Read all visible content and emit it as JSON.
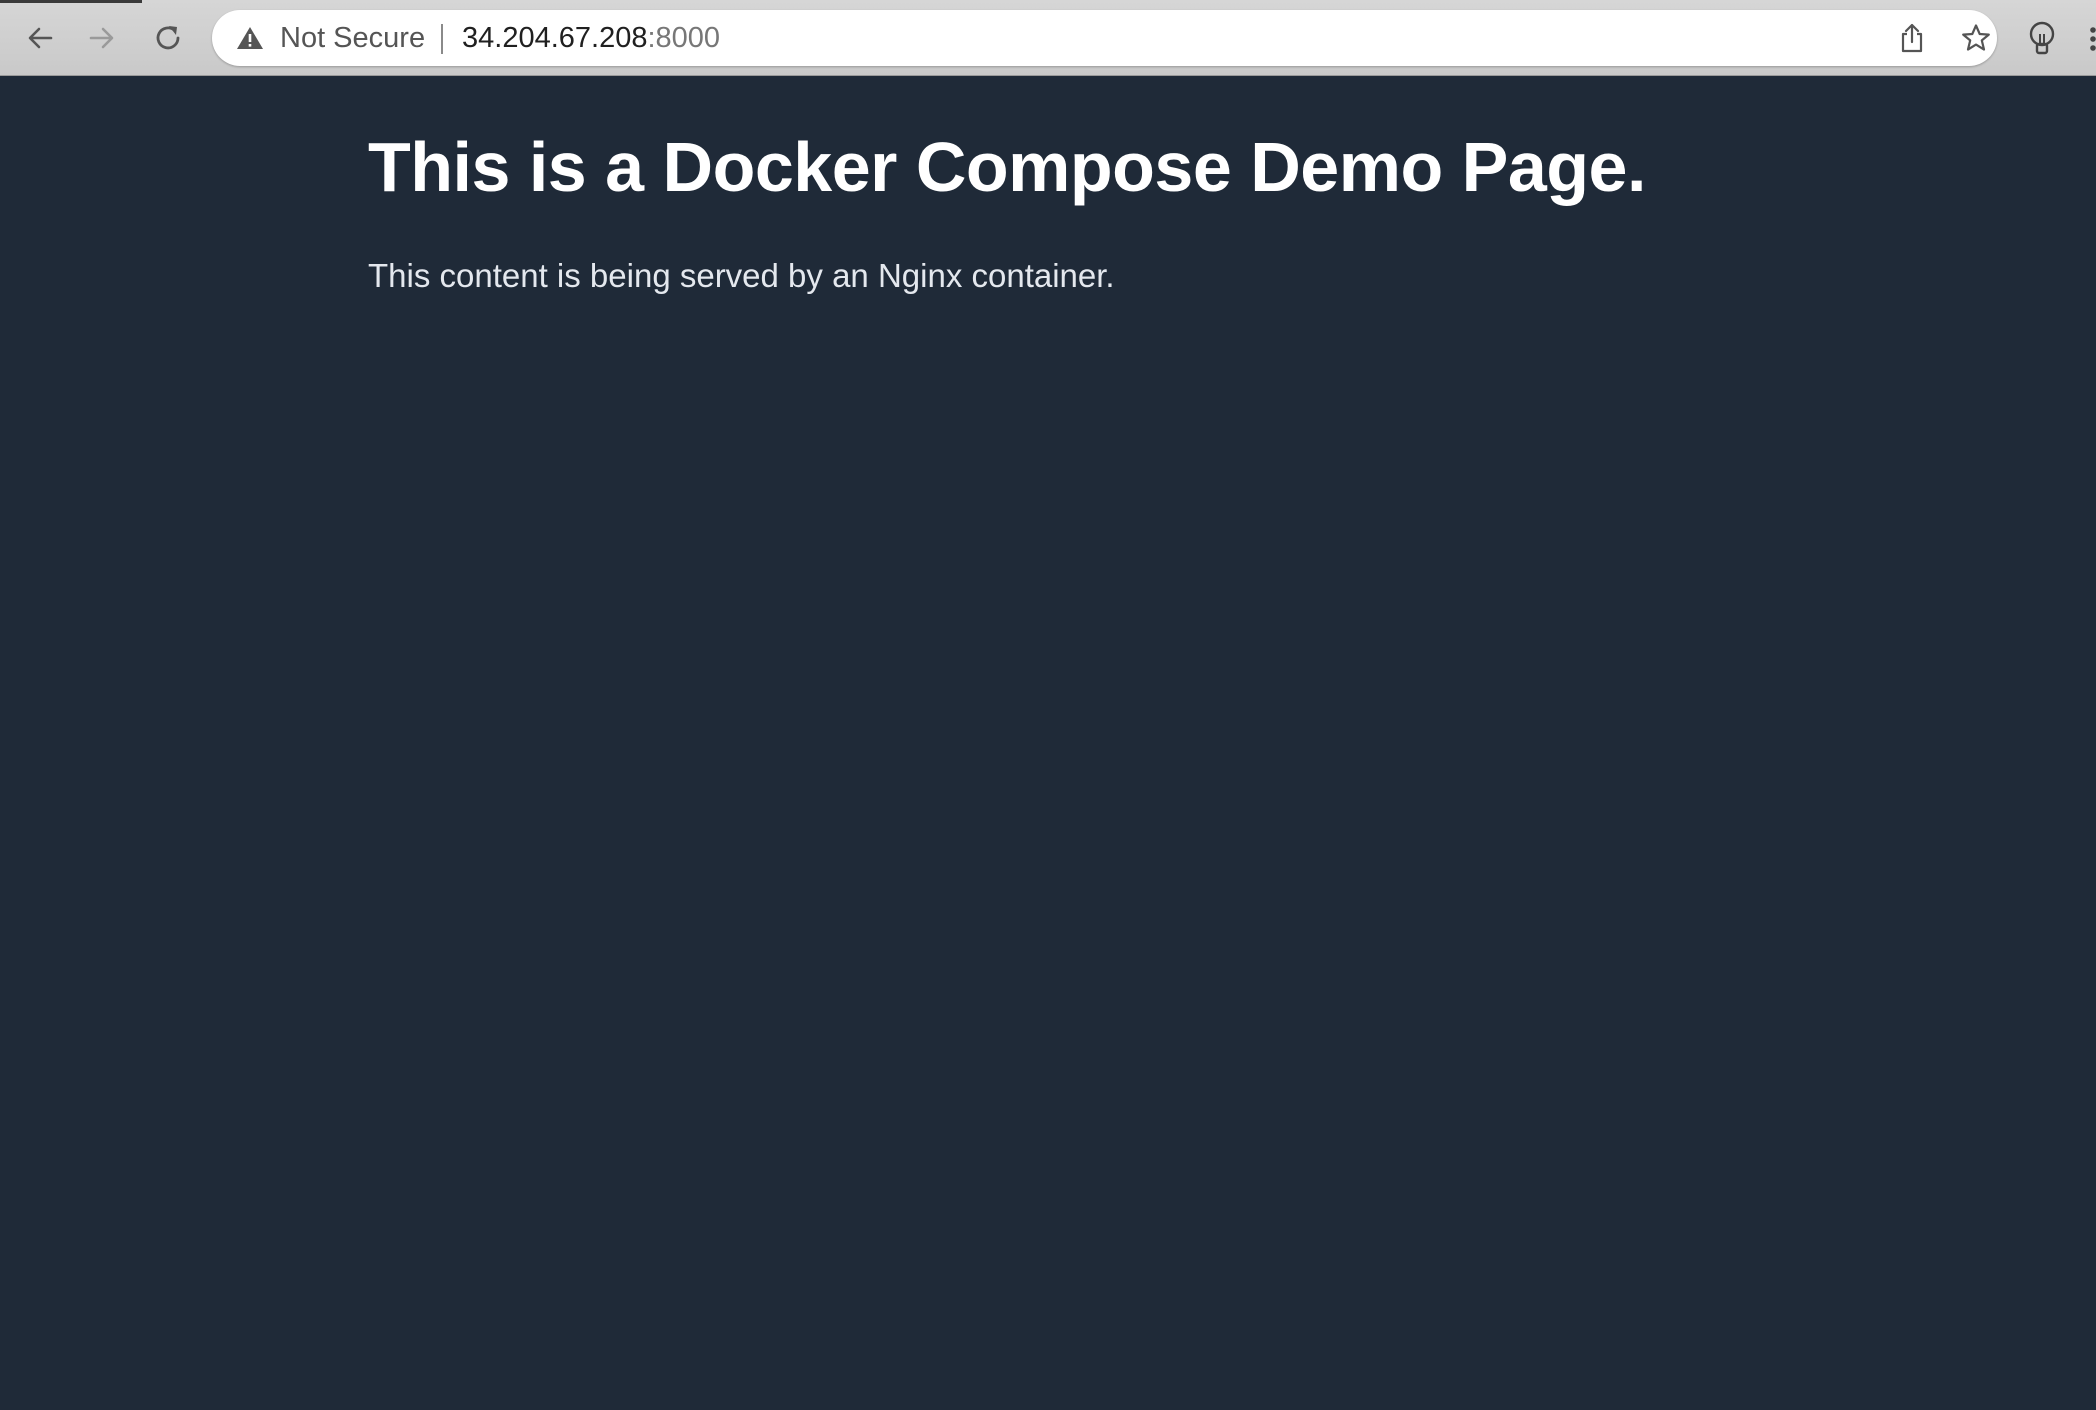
{
  "browser": {
    "security_label": "Not Secure",
    "url_host": "34.204.67.208",
    "url_port": ":8000",
    "icons": {
      "back": "back-arrow-icon",
      "forward": "forward-arrow-icon",
      "reload": "reload-icon",
      "warning": "warning-triangle-icon",
      "share": "share-icon",
      "bookmark": "star-icon",
      "extension": "lightbulb-icon",
      "menu": "menu-dots-icon"
    }
  },
  "page": {
    "heading": "This is a Docker Compose Demo Page.",
    "body_text": "This content is being served by an Nginx container."
  },
  "colors": {
    "page_background": "#1f2a38",
    "heading": "#ffffff",
    "body_text": "#e4e8ee"
  }
}
